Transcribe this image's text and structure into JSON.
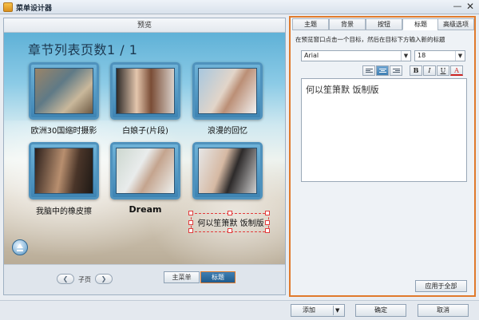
{
  "window": {
    "title": "菜单设计器",
    "minimize": "—",
    "close": "✕"
  },
  "preview": {
    "header": "预览",
    "heading": "章节列表页数1 / 1",
    "thumbs": [
      {
        "label": "欧洲30国缩时摄影"
      },
      {
        "label": "白娘子(片段)"
      },
      {
        "label": "浪漫的回忆"
      },
      {
        "label": "我脑中的橡皮擦"
      },
      {
        "label": "Dream"
      },
      {
        "label": "何以笙箫默 饭制版"
      }
    ],
    "pager": {
      "prev": "❮",
      "next": "❯",
      "label": "子页"
    },
    "mode_buttons": {
      "main_menu": "主菜单",
      "title": "标题"
    }
  },
  "right_panel": {
    "tabs": [
      "主题",
      "背景",
      "按钮",
      "标题",
      "高级选项"
    ],
    "active_tab": "标题",
    "instruction": "在预览窗口点击一个目标，然后在目标下方输入新的标题",
    "font": "Arial",
    "size": "18",
    "format": {
      "bold": "B",
      "italic": "I",
      "underline": "U",
      "color": "A"
    },
    "editor_text": "何以笙箫默 饭制版",
    "apply_all": "应用于全部"
  },
  "bottom": {
    "add": "添加",
    "ok": "确定",
    "cancel": "取消"
  },
  "icons": {
    "dropdown": "chevron-down-icon",
    "up": "arrow-up-icon"
  },
  "colors": {
    "accent": "#e07a2c",
    "selection": "#e13c3c",
    "primary": "#3f7fb3",
    "text_color_mark": "#cc2222"
  }
}
